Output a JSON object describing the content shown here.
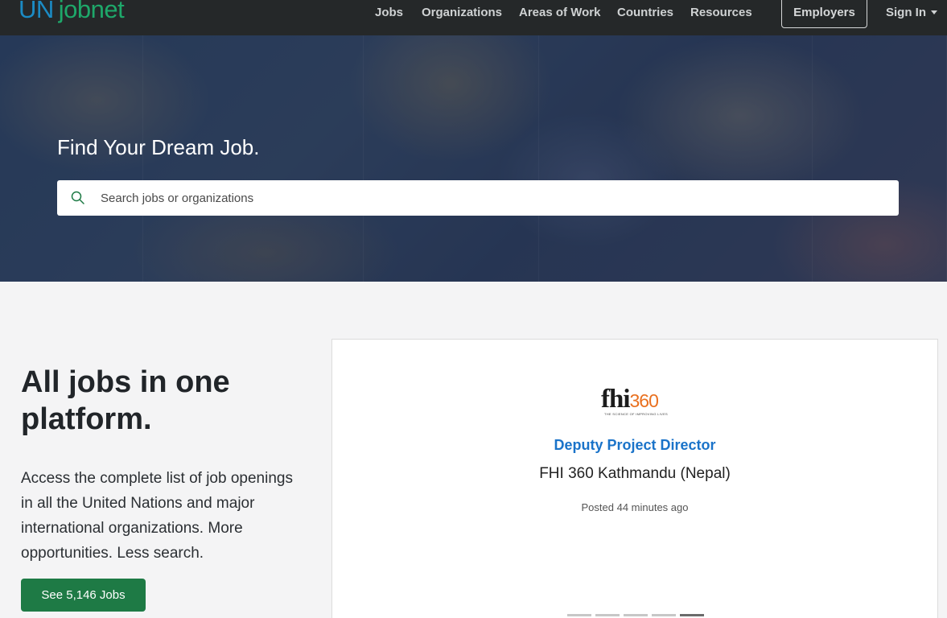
{
  "navbar": {
    "logo_un": "UN",
    "logo_jobnet": "jobnet",
    "links": [
      "Jobs",
      "Organizations",
      "Areas of Work",
      "Countries",
      "Resources"
    ],
    "employers": "Employers",
    "signin": "Sign In"
  },
  "hero": {
    "title": "Find Your Dream Job.",
    "search_placeholder": "Search jobs or organizations"
  },
  "intro": {
    "headline": "All jobs in one platform.",
    "text": "Access the complete list of job openings in all the United Nations and major international organizations. More opportunities. Less search.",
    "button": "See 5,146 Jobs"
  },
  "featured_job": {
    "logo_main": "fhi",
    "logo_360": "360",
    "logo_tagline": "THE SCIENCE OF IMPROVING LIVES",
    "title": "Deputy Project Director",
    "organization": "FHI 360 Kathmandu (Nepal)",
    "posted": "Posted 44 minutes ago",
    "carousel_count": 5,
    "carousel_active": 5
  },
  "colors": {
    "navbar": "#252829",
    "brand_blue": "#1b8bc4",
    "brand_green": "#1ea86a",
    "button_green": "#1e7a45",
    "link_blue": "#1a73c9",
    "fhi_orange": "#e9701f"
  }
}
